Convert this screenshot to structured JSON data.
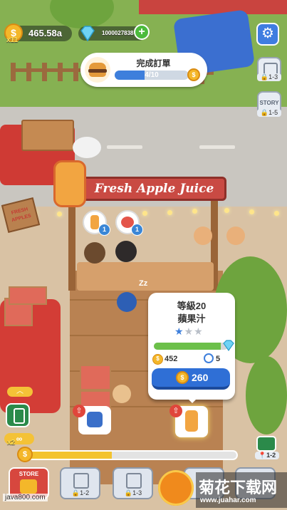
{
  "hud": {
    "coins": "465.58a",
    "multiplier": "x11",
    "gems": "1000027838",
    "plus_label": "+"
  },
  "order": {
    "title": "完成訂單",
    "progress_text": "4/10",
    "progress": 0.4
  },
  "side_buttons": [
    {
      "lock": "1-3"
    },
    {
      "label": "STORY",
      "lock": "1-5"
    }
  ],
  "shop": {
    "sign": "Fresh Apple Juice",
    "side_sign": "FRESH APPLES"
  },
  "customers": [
    {
      "count": "1"
    },
    {
      "count": "1"
    }
  ],
  "info_panel": {
    "level": "等級20",
    "product": "蘋果汁",
    "stars_filled": 1,
    "stars_total": 3,
    "progress": 0.9,
    "stat_value": "452",
    "stat_speed": "5",
    "upgrade_cost": "260"
  },
  "bottom": {
    "multiplier": "x2",
    "progress": 0.4,
    "level_label": "1-2",
    "tabs": [
      {
        "label": "STORE"
      },
      {
        "lock": "1-2"
      },
      {
        "lock": "1-3"
      },
      {
        "lock": ""
      }
    ]
  },
  "watermark": {
    "site": "java800.com",
    "brand": "菊花下载网",
    "url": "www.juahar.com"
  },
  "colors": {
    "accent_blue": "#2f6fd6",
    "coin_gold": "#f4b72a",
    "sign_red": "#c94a43",
    "progress_green": "#6cc04a"
  }
}
